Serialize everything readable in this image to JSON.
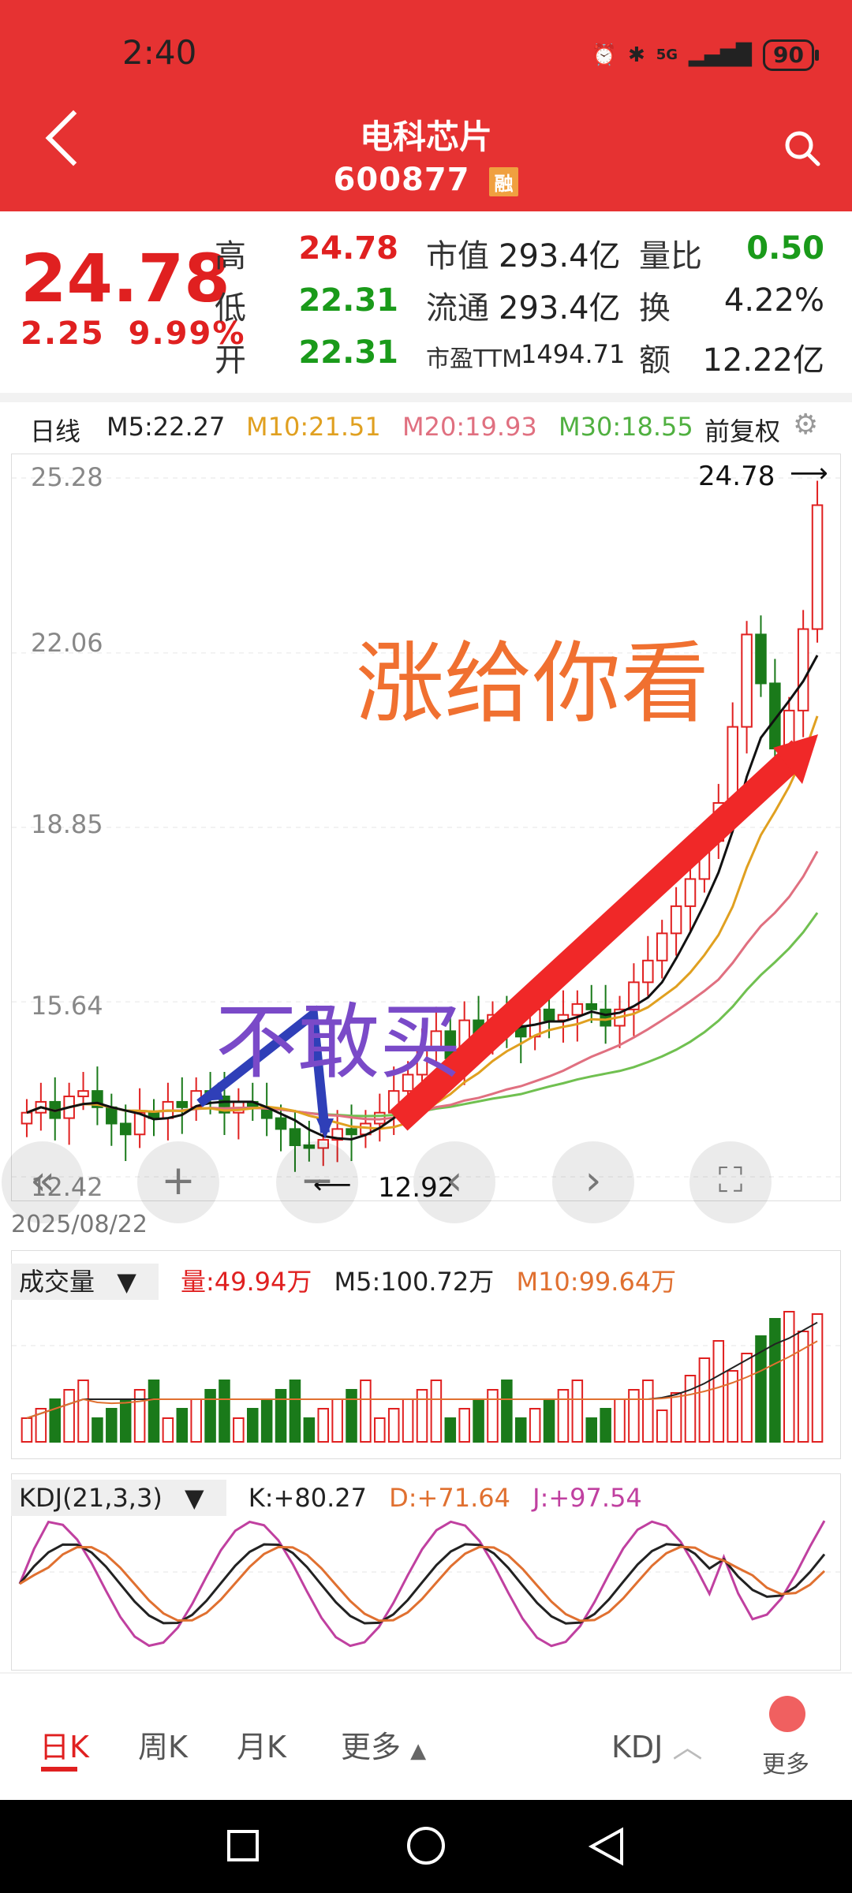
{
  "status": {
    "time": "2:40",
    "network": "5G",
    "battery": "90"
  },
  "header": {
    "title": "电科芯片",
    "code": "600877",
    "margin_badge": "融"
  },
  "quote": {
    "price": "24.78",
    "change": "2.25",
    "change_pct": "9.99%",
    "rows": [
      {
        "label": "高",
        "value": "24.78",
        "m_label": "市值",
        "m_value": "293.4亿",
        "r_label": "量比",
        "r_value": "0.50"
      },
      {
        "label": "低",
        "value": "22.31",
        "m_label": "流通",
        "m_value": "293.4亿",
        "r_label": "换",
        "r_value": "4.22%"
      },
      {
        "label": "开",
        "value": "22.31",
        "m_label": "市盈TTM",
        "m_value": "1494.71",
        "r_label": "额",
        "r_value": "12.22亿"
      }
    ]
  },
  "legend": {
    "period": "日线",
    "m5": "M5:22.27",
    "m10": "M10:21.51",
    "m20": "M20:19.93",
    "m30": "M30:18.55",
    "adjust": "前复权"
  },
  "colors": {
    "up": "#e02020",
    "down": "#1a7a1a",
    "m5": "#111111",
    "m10": "#e0a020",
    "m20": "#e07080",
    "m30": "#70c050",
    "accent": "#e63232"
  },
  "kline": {
    "y_ticks": [
      "25.28",
      "22.06",
      "18.85",
      "15.64",
      "12.42"
    ],
    "high_label": "24.78",
    "low_label": "12.92",
    "date": "2025/08/22",
    "annotation_buy": "不敢买",
    "annotation_rise": "涨给你看"
  },
  "controls": [
    "«",
    "+",
    "−",
    "‹",
    "›",
    "⛶"
  ],
  "volume": {
    "selector": "成交量",
    "vol": "量:49.94万",
    "m5": "M5:100.72万",
    "m10": "M10:99.64万"
  },
  "kdj": {
    "selector": "KDJ(21,3,3)",
    "k": "K:+80.27",
    "d": "D:+71.64",
    "j": "J:+97.54"
  },
  "tabs": {
    "day": "日K",
    "week": "周K",
    "month": "月K",
    "more": "更多",
    "indicator": "KDJ",
    "more_btn": "更多"
  },
  "chart_data": {
    "type": "candlestick",
    "last_date": "2025/08/22",
    "ylim": [
      12.42,
      25.28
    ],
    "y_ticks": [
      25.28,
      22.06,
      18.85,
      15.64,
      12.42
    ],
    "last_close": 24.78,
    "range_high": 24.78,
    "range_low": 12.92,
    "close_series": [
      13.6,
      13.8,
      13.5,
      13.9,
      14.0,
      13.7,
      13.4,
      13.2,
      13.6,
      13.5,
      13.8,
      13.7,
      14.0,
      13.9,
      13.6,
      13.8,
      13.7,
      13.5,
      13.3,
      13.0,
      12.95,
      13.1,
      13.3,
      13.2,
      13.4,
      13.6,
      14.0,
      14.3,
      14.8,
      15.1,
      14.6,
      15.3,
      15.0,
      15.4,
      15.2,
      15.0,
      15.5,
      15.3,
      15.4,
      15.6,
      15.5,
      15.2,
      15.5,
      16.0,
      16.4,
      16.9,
      17.4,
      17.9,
      18.6,
      19.3,
      20.7,
      22.4,
      21.5,
      20.3,
      21.0,
      22.5,
      24.78
    ],
    "ma": {
      "M5": 22.27,
      "M10": 21.51,
      "M20": 19.93,
      "M30": 18.55
    },
    "volume": {
      "last": "49.94万",
      "M5": "100.72万",
      "M10": "99.64万"
    },
    "kdj": {
      "params": "21,3,3",
      "K": 80.27,
      "D": 71.64,
      "J": 97.54
    }
  }
}
